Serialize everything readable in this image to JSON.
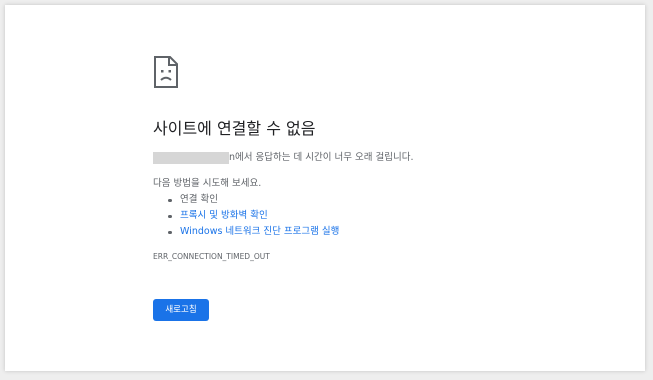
{
  "error": {
    "icon": "sad-document-icon",
    "title": "사이트에 연결할 수 없음",
    "reason_text": "에서 응답하는 데 시간이 너무 오래 걸립니다.",
    "host_partial": "n",
    "suggestions_title": "다음 방법을 시도해 보세요.",
    "suggestions": [
      {
        "label": "연결 확인",
        "link": false
      },
      {
        "label": "프록시 및 방화벽 확인",
        "link": true
      },
      {
        "label": "Windows 네트워크 진단 프로그램 실행",
        "link": true
      }
    ],
    "code": "ERR_CONNECTION_TIMED_OUT",
    "reload_label": "새로고침"
  },
  "colors": {
    "accent": "#1a73e8",
    "text_primary": "#202124",
    "text_secondary": "#5f6368",
    "redaction": "#d6d6d6"
  }
}
